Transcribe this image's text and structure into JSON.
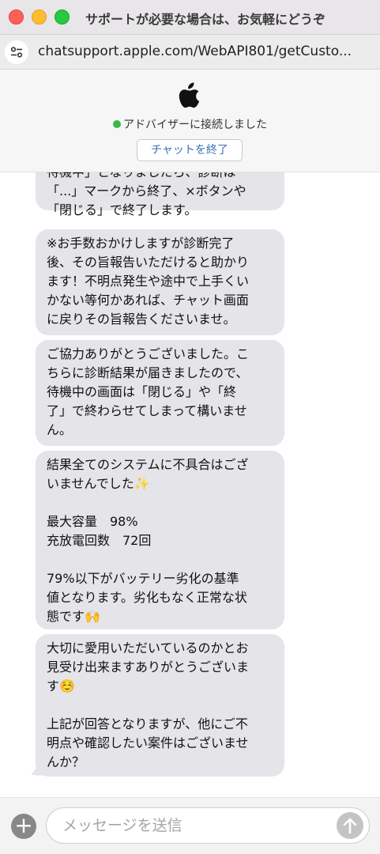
{
  "window": {
    "title": "サポートが必要な場合は、お気軽にどうぞ"
  },
  "address_bar": {
    "url": "chatsupport.apple.com/WebAPI801/getCusto..."
  },
  "chat_header": {
    "status": "アドバイザーに接続しました",
    "end_chat_label": "チャットを終了"
  },
  "messages": [
    {
      "lines": [
        "待機中」となりましたら、診断は",
        "「...」マークから終了、×ボタンや",
        "「閉じる」で終了します。"
      ]
    },
    {
      "lines": [
        "※お手数おかけしますが診断完了",
        "後、その旨報告いただけると助かり",
        "ます！不明点発生や途中で上手くい",
        "かない等何かあれば、チャット画面",
        "に戻りその旨報告くださいませ。"
      ]
    },
    {
      "lines": [
        "ご協力ありがとうございました。こ",
        "ちらに診断結果が届きましたので、",
        "待機中の画面は「閉じる」や「終",
        "了」で終わらせてしまって構いませ",
        "ん。"
      ]
    },
    {
      "lines": [
        "結果全てのシステムに不具合はござ",
        "いませんでした✨",
        "",
        "最大容量　98%",
        "充放電回数　72回",
        "",
        "79%以下がバッテリー劣化の基準",
        "値となります。劣化もなく正常な状",
        "態です🙌"
      ]
    },
    {
      "lines": [
        "大切に愛用いただいているのかとお",
        "見受け出来ますありがとうございま",
        "す☺️",
        "",
        "上記が回答となりますが、他にご不",
        "明点や確認したい案件はございませ",
        "んか？"
      ]
    }
  ],
  "composer": {
    "placeholder": "メッセージを送信",
    "value": ""
  },
  "icons": {
    "window_close": "close-window-icon",
    "window_minimize": "minimize-window-icon",
    "window_zoom": "zoom-window-icon",
    "site_settings": "sliders-icon",
    "brand": "apple-logo-icon",
    "attach": "plus-icon",
    "send": "arrow-up-icon"
  },
  "colors": {
    "bubble_bg": "#e4e4e9",
    "status_dot": "#3cb846",
    "button_text": "#3a6fb5"
  }
}
